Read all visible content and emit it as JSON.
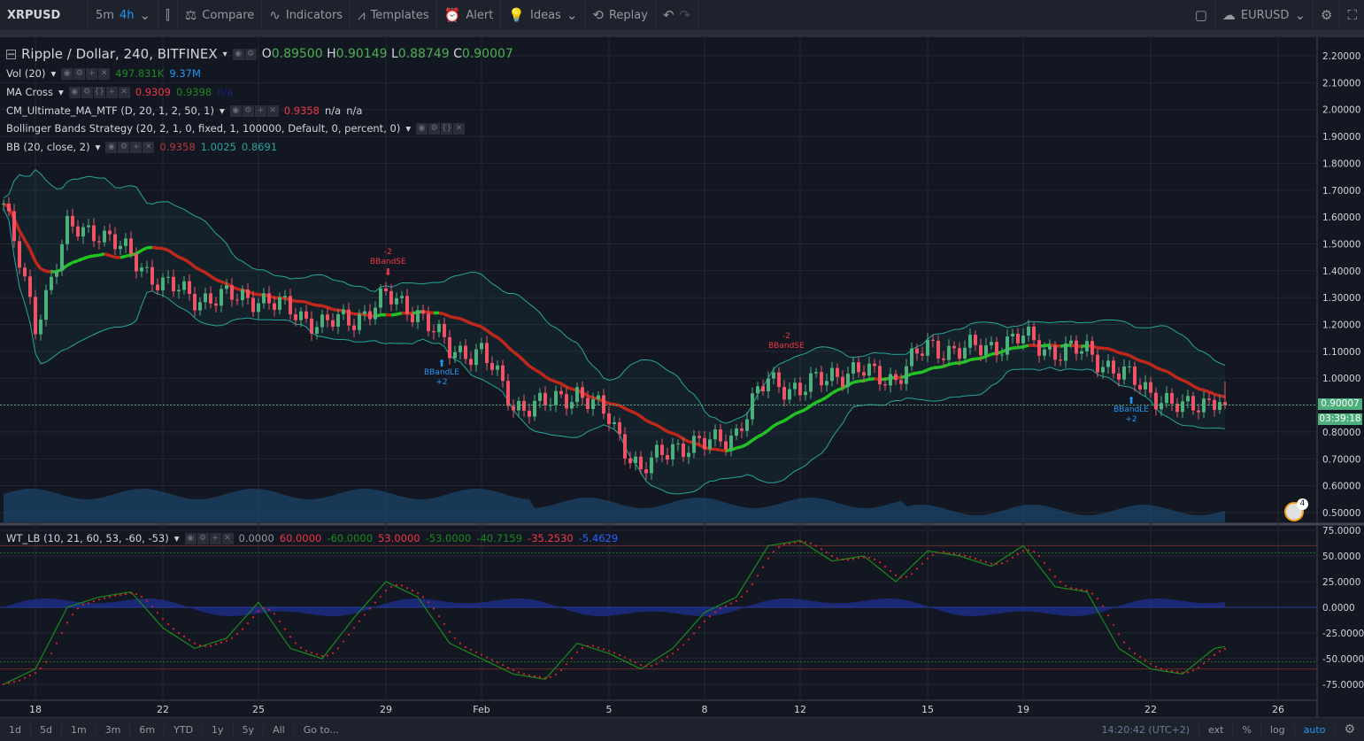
{
  "toolbar": {
    "symbol": "XRPUSD",
    "intervals": [
      "5m",
      "4h"
    ],
    "compare": "Compare",
    "indicators": "Indicators",
    "templates": "Templates",
    "alert": "Alert",
    "ideas": "Ideas",
    "replay": "Replay",
    "compare_symbol": "EURUSD"
  },
  "legend": {
    "title": "Ripple / Dollar, 240, BITFINEX",
    "o_label": "O",
    "o": "0.89500",
    "h_label": "H",
    "h": "0.90149",
    "l_label": "L",
    "l": "0.88749",
    "c_label": "C",
    "c": "0.90007",
    "vol": {
      "name": "Vol (20)",
      "v1": "497.831K",
      "v2": "9.37M"
    },
    "ma_cross": {
      "name": "MA Cross",
      "v1": "0.9309",
      "v2": "0.9398",
      "v3": "n/a"
    },
    "cm": {
      "name": "CM_Ultimate_MA_MTF (D, 20, 1, 2, 50, 1)",
      "v1": "0.9358",
      "v2": "n/a",
      "v3": "n/a"
    },
    "bbs": {
      "name": "Bollinger Bands Strategy (20, 2, 1, 0, fixed, 1, 100000, Default, 0, percent, 0)"
    },
    "bb": {
      "name": "BB (20, close, 2)",
      "v1": "0.9358",
      "v2": "1.0025",
      "v3": "0.8691"
    },
    "wt": {
      "name": "WT_LB (10, 21, 60, 53, -60, -53)",
      "v": [
        "0.0000",
        "60.0000",
        "-60.0000",
        "53.0000",
        "-53.0000",
        "-40.7159",
        "-35.2530",
        "-5.4629"
      ]
    }
  },
  "markers": [
    {
      "top": "-2",
      "bottom": "BBandSE",
      "type": "short"
    },
    {
      "top": "BBandLE",
      "bottom": "+2",
      "type": "long"
    },
    {
      "top": "-2",
      "bottom": "BBandSE",
      "type": "short"
    },
    {
      "top": "BBandLE",
      "bottom": "+2",
      "type": "long"
    }
  ],
  "price_tag": "0.90007",
  "countdown": "03:39:18",
  "event_count": "4",
  "bottom": {
    "ranges": [
      "1d",
      "5d",
      "1m",
      "3m",
      "6m",
      "YTD",
      "1y",
      "5y",
      "All"
    ],
    "goto": "Go to...",
    "time": "14:20:42 (UTC+2)",
    "ext": "ext",
    "pct": "%",
    "log": "log",
    "auto": "auto"
  },
  "chart_data": {
    "type": "candlestick",
    "symbol": "XRPUSD",
    "interval": "240",
    "price_ticks": [
      "2.20000",
      "2.10000",
      "2.00000",
      "1.90000",
      "1.80000",
      "1.70000",
      "1.60000",
      "1.50000",
      "1.40000",
      "1.30000",
      "1.20000",
      "1.10000",
      "1.00000",
      "0.90000",
      "0.80000",
      "0.70000",
      "0.60000",
      "0.50000"
    ],
    "osc_ticks": [
      "75.0000",
      "50.0000",
      "25.0000",
      "0.0000",
      "-25.0000",
      "-50.0000",
      "-75.0000"
    ],
    "date_ticks": [
      "18",
      "22",
      "25",
      "29",
      "Feb",
      "5",
      "8",
      "12",
      "15",
      "19",
      "22",
      "26"
    ],
    "daily_close_approx": [
      1.65,
      1.2,
      1.55,
      1.55,
      1.45,
      1.35,
      1.3,
      1.3,
      1.3,
      1.25,
      1.2,
      1.22,
      1.3,
      1.25,
      1.1,
      1.1,
      0.9,
      0.9,
      0.95,
      0.85,
      0.65,
      0.75,
      0.75,
      0.8,
      1.0,
      0.95,
      1.02,
      1.02,
      1.0,
      1.12,
      1.1,
      1.12,
      1.15,
      1.1,
      1.1,
      1.02,
      0.95,
      0.88,
      0.93,
      0.9
    ],
    "wt1_daily_approx": [
      -75,
      -60,
      0,
      10,
      15,
      -20,
      -40,
      -30,
      5,
      -40,
      -50,
      -10,
      25,
      10,
      -35,
      -50,
      -65,
      -70,
      -35,
      -45,
      -60,
      -40,
      -5,
      10,
      60,
      65,
      45,
      50,
      25,
      55,
      50,
      40,
      60,
      20,
      15,
      -40,
      -60,
      -65,
      -40,
      -35
    ],
    "osc_levels": [
      60,
      53,
      0,
      -53,
      -60
    ]
  }
}
